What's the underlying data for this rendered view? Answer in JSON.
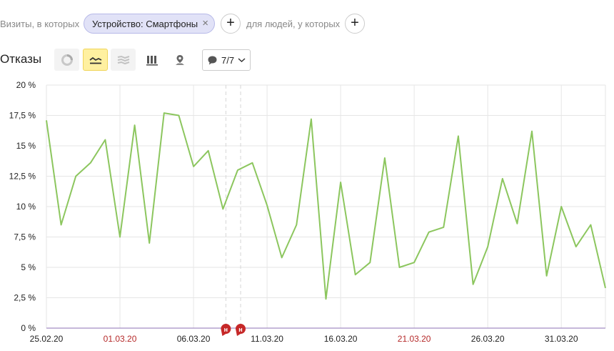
{
  "filters": {
    "visits_label": "Визиты, в которых",
    "chip_label": "Устройство: Смартфоны",
    "people_label": "для людей, у которых"
  },
  "toolbar": {
    "title": "Отказы",
    "annotations_count": "7/7",
    "icons": [
      "pie-chart-icon",
      "line-chart-icon",
      "area-chart-icon",
      "bar-chart-icon",
      "map-pin-icon"
    ]
  },
  "colors": {
    "line": "#8cc65e",
    "grid": "#e6e6e6",
    "holiday": "#b52a2a",
    "active_btn": "#fff0a0"
  },
  "chart_data": {
    "type": "line",
    "ylim": [
      0,
      20
    ],
    "yticks": [
      "0 %",
      "2,5 %",
      "5 %",
      "7,5 %",
      "10 %",
      "12,5 %",
      "15 %",
      "17,5 %",
      "20 %"
    ],
    "xticks": [
      {
        "label": "25.02.20",
        "index": 0,
        "holiday": false
      },
      {
        "label": "01.03.20",
        "index": 5,
        "holiday": true
      },
      {
        "label": "06.03.20",
        "index": 10,
        "holiday": false
      },
      {
        "label": "11.03.20",
        "index": 15,
        "holiday": false
      },
      {
        "label": "16.03.20",
        "index": 20,
        "holiday": false
      },
      {
        "label": "21.03.20",
        "index": 25,
        "holiday": true
      },
      {
        "label": "26.03.20",
        "index": 30,
        "holiday": false
      },
      {
        "label": "31.03.20",
        "index": 35,
        "holiday": false
      }
    ],
    "markers": [
      {
        "label": "н",
        "index": 12.2
      },
      {
        "label": "н",
        "index": 13.2
      }
    ],
    "x": [
      "25.02.20",
      "26.02.20",
      "27.02.20",
      "28.02.20",
      "29.02.20",
      "01.03.20",
      "02.03.20",
      "03.03.20",
      "04.03.20",
      "05.03.20",
      "06.03.20",
      "07.03.20",
      "08.03.20",
      "09.03.20",
      "10.03.20",
      "11.03.20",
      "12.03.20",
      "13.03.20",
      "14.03.20",
      "15.03.20",
      "16.03.20",
      "17.03.20",
      "18.03.20",
      "19.03.20",
      "20.03.20",
      "21.03.20",
      "22.03.20",
      "23.03.20",
      "24.03.20",
      "25.03.20",
      "26.03.20",
      "27.03.20",
      "28.03.20",
      "29.03.20",
      "30.03.20",
      "31.03.20",
      "01.04.20",
      "02.04.20",
      "03.04.20"
    ],
    "series": [
      {
        "values": [
          17.1,
          8.5,
          12.5,
          13.6,
          15.5,
          7.5,
          16.7,
          7.0,
          17.7,
          17.5,
          13.3,
          14.6,
          9.8,
          13.0,
          13.6,
          10.1,
          5.8,
          8.5,
          17.2,
          2.4,
          12.0,
          4.4,
          5.4,
          14.0,
          5.0,
          5.4,
          7.9,
          8.3,
          15.8,
          3.6,
          6.7,
          12.3,
          8.6,
          16.2,
          4.3,
          10.0,
          6.7,
          8.5,
          3.3
        ]
      }
    ]
  }
}
